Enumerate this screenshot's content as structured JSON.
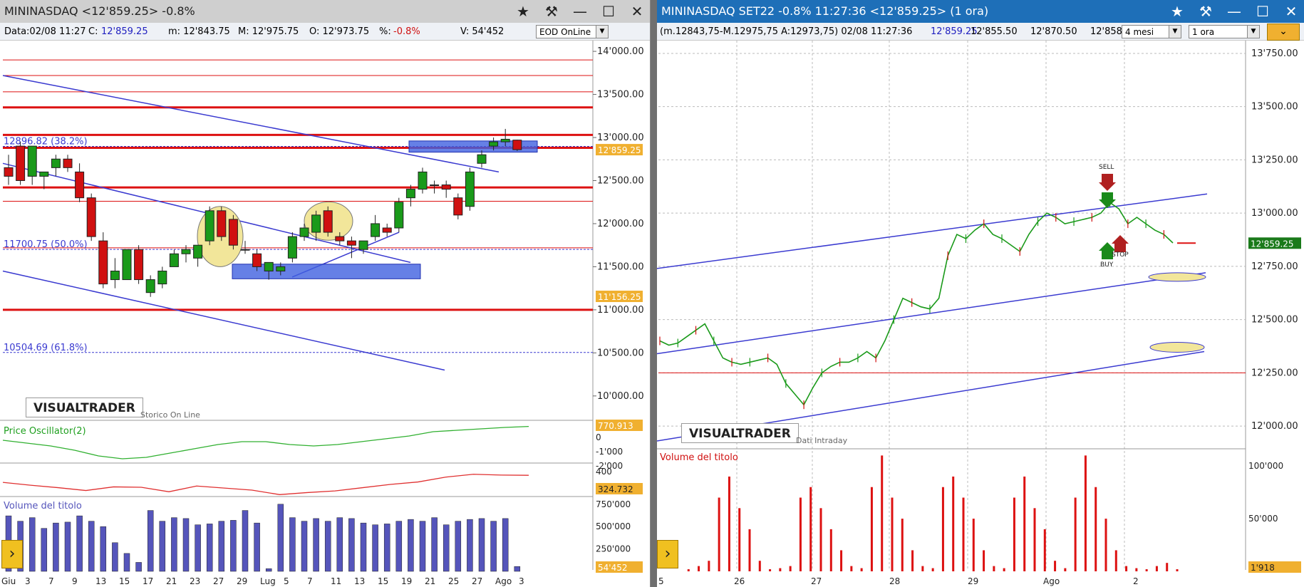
{
  "left": {
    "title": "MININASDAQ <12'859.25> -0.8%",
    "info": {
      "date": "Data:02/08 11:27",
      "close_label": "C:",
      "close": "12'859.25",
      "min": "m: 12'843.75",
      "max": "M: 12'975.75",
      "open": "O: 12'973.75",
      "pct_label": "%:",
      "pct": "-0.8%",
      "volume": "V: 54'452"
    },
    "mode_select": "EOD OnLine",
    "logo": "VISUALTRADER",
    "logo_note": "Storico On Line",
    "osc_label": "Price Oscillator(2)",
    "vol_label": "Volume del titolo",
    "fib": [
      {
        "label": "12896.82 (38.2%)",
        "value": 12896.82
      },
      {
        "label": "11700.75 (50.0%)",
        "value": 11700.75
      },
      {
        "label": "10504.69 (61.8%)",
        "value": 10504.69
      }
    ],
    "price_badges": {
      "last": "12'859.25",
      "low": "11'156.25"
    },
    "osc_badges": {
      "top": "770.913",
      "bottom": "324.732"
    },
    "vol_badge": "54'452",
    "osc_ticks": [
      "0",
      "-1'000",
      "-2'000",
      "400"
    ],
    "x_labels": [
      "Giu",
      "3",
      "7",
      "9",
      "13",
      "15",
      "17",
      "21",
      "23",
      "27",
      "29",
      "Lug",
      "5",
      "7",
      "11",
      "13",
      "15",
      "19",
      "21",
      "25",
      "27",
      "Ago",
      "3"
    ]
  },
  "right": {
    "title": "MININASDAQ SET22 -0.8% 11:27:36 <12'859.25> (1 ora)",
    "info": {
      "range": "(m.12843,75-M.12975,75 A:12973,75) 02/08 11:27:36",
      "last": "12'859.25",
      "bid": "12'855.50",
      "ask": "12'870.50",
      "cut": "12'858."
    },
    "period_select": "4 mesi",
    "interval_select": "1 ora",
    "logo": "VISUALTRADER",
    "logo_note": "Dati Intraday",
    "vol_label": "Volume del titolo",
    "price_badge": "12'859.25",
    "vol_badge": "1'918",
    "signals": {
      "sell": "SELL",
      "buy": "BUY",
      "stop": "STOP"
    },
    "x_labels": [
      "5",
      "26",
      "27",
      "28",
      "29",
      "Ago",
      "2"
    ]
  },
  "colors": {
    "up": "#1a9a1a",
    "down": "#d01010",
    "fib": "#3a3ad0",
    "volume_left": "#5555bb",
    "volume_right": "#dd1111",
    "badge": "#f0b030",
    "badge_green": "#1a7a1a"
  },
  "chart_data": [
    {
      "type": "candlestick",
      "title": "MININASDAQ <12'859.25> -0.8%",
      "ylim": [
        9800,
        14100
      ],
      "y_ticks": [
        10000,
        10500,
        11000,
        11500,
        12000,
        12500,
        13000,
        13500,
        14000
      ],
      "y_tick_labels": [
        "10'000.00",
        "10'500.00",
        "11'000.00",
        "11'500.00",
        "12'000.00",
        "12'500.00",
        "13'000.00",
        "13'500.00",
        "14'000.00"
      ],
      "horizontal_lines": [
        13350,
        13030,
        12880,
        12420,
        12260,
        11720,
        11000,
        13720,
        13900,
        13530
      ],
      "grid": false,
      "candles": [
        [
          12650,
          12800,
          12450,
          12550
        ],
        [
          12900,
          12950,
          12450,
          12500
        ],
        [
          12550,
          12900,
          12450,
          12900
        ],
        [
          12550,
          12600,
          12400,
          12600
        ],
        [
          12650,
          12800,
          12550,
          12750
        ],
        [
          12750,
          12800,
          12600,
          12650
        ],
        [
          12600,
          12700,
          12250,
          12300
        ],
        [
          12300,
          12350,
          11800,
          11850
        ],
        [
          11800,
          11900,
          11250,
          11300
        ],
        [
          11350,
          11600,
          11250,
          11450
        ],
        [
          11350,
          11700,
          11350,
          11700
        ],
        [
          11700,
          11750,
          11300,
          11350
        ],
        [
          11200,
          11400,
          11150,
          11350
        ],
        [
          11300,
          11500,
          11250,
          11450
        ],
        [
          11500,
          11700,
          11500,
          11650
        ],
        [
          11650,
          11750,
          11550,
          11700
        ],
        [
          11600,
          11750,
          11500,
          11750
        ],
        [
          11800,
          12200,
          11750,
          12150
        ],
        [
          12150,
          12200,
          11800,
          11850
        ],
        [
          12050,
          12100,
          11700,
          11750
        ],
        [
          11700,
          11800,
          11650,
          11700
        ],
        [
          11650,
          11700,
          11450,
          11500
        ],
        [
          11450,
          11550,
          11350,
          11550
        ],
        [
          11450,
          11550,
          11400,
          11500
        ],
        [
          11600,
          11900,
          11550,
          11850
        ],
        [
          11850,
          12000,
          11800,
          11950
        ],
        [
          11900,
          12150,
          11800,
          12100
        ],
        [
          12150,
          12200,
          11850,
          11900
        ],
        [
          11850,
          11900,
          11750,
          11800
        ],
        [
          11800,
          11850,
          11600,
          11750
        ],
        [
          11700,
          11800,
          11650,
          11800
        ],
        [
          11850,
          12100,
          11800,
          12000
        ],
        [
          11950,
          12000,
          11850,
          11900
        ],
        [
          11950,
          12300,
          11900,
          12250
        ],
        [
          12300,
          12450,
          12200,
          12400
        ],
        [
          12400,
          12650,
          12350,
          12600
        ],
        [
          12450,
          12500,
          12350,
          12450
        ],
        [
          12450,
          12500,
          12300,
          12400
        ],
        [
          12300,
          12350,
          12050,
          12100
        ],
        [
          12200,
          12650,
          12150,
          12600
        ],
        [
          12700,
          12850,
          12650,
          12800
        ],
        [
          12900,
          13000,
          12850,
          12950
        ],
        [
          12950,
          13100,
          12900,
          12980
        ],
        [
          12970,
          12975,
          12843,
          12859
        ]
      ],
      "oscillator": [
        -200,
        -400,
        -600,
        -900,
        -1300,
        -1500,
        -1400,
        -1100,
        -800,
        -500,
        -300,
        -300,
        -500,
        -600,
        -500,
        -300,
        -100,
        100,
        400,
        500,
        600,
        700,
        770
      ],
      "oscillator2": [
        150,
        80,
        20,
        -50,
        40,
        30,
        -80,
        60,
        10,
        -40,
        -150,
        -100,
        -60,
        20,
        100,
        160,
        280,
        350,
        330,
        324
      ],
      "volume": [
        620,
        560,
        600,
        480,
        540,
        550,
        620,
        560,
        500,
        320,
        200,
        100,
        680,
        560,
        600,
        590,
        520,
        530,
        560,
        570,
        680,
        540,
        30,
        750,
        600,
        560,
        590,
        560,
        600,
        590,
        540,
        520,
        530,
        560,
        580,
        560,
        600,
        520,
        560,
        580,
        590,
        560,
        590,
        54
      ]
    },
    {
      "type": "line",
      "title": "MININASDAQ SET22 -0.8% 11:27:36 <12'859.25> (1 ora)",
      "ylim": [
        11900,
        13800
      ],
      "y_ticks": [
        12000,
        12250,
        12500,
        12750,
        13000,
        13250,
        13500,
        13750
      ],
      "y_tick_labels": [
        "12'000.00",
        "12'250.00",
        "12'500.00",
        "12'750.00",
        "13'000.00",
        "13'250.00",
        "13'500.00",
        "13'750.00"
      ],
      "horizontal_lines": [
        12250
      ],
      "grid": true,
      "prices": [
        12400,
        12380,
        12390,
        12420,
        12450,
        12480,
        12400,
        12320,
        12300,
        12290,
        12300,
        12310,
        12320,
        12290,
        12200,
        12150,
        12100,
        12180,
        12250,
        12280,
        12300,
        12300,
        12320,
        12350,
        12320,
        12400,
        12500,
        12600,
        12580,
        12560,
        12550,
        12600,
        12800,
        12900,
        12880,
        12920,
        12950,
        12900,
        12880,
        12850,
        12820,
        12900,
        12960,
        13000,
        12980,
        12950,
        12960,
        12970,
        12980,
        13000,
        13050,
        13020,
        12950,
        12980,
        12950,
        12920,
        12900,
        12860
      ],
      "volume": [
        0,
        2,
        5,
        10,
        70,
        90,
        60,
        40,
        10,
        2,
        3,
        5,
        70,
        80,
        60,
        40,
        20,
        5,
        3,
        80,
        110,
        70,
        50,
        20,
        5,
        3,
        80,
        90,
        70,
        50,
        20,
        5,
        3,
        70,
        90,
        60,
        40,
        10,
        3,
        70,
        110,
        80,
        50,
        20,
        5,
        3,
        2,
        5,
        8,
        2
      ]
    }
  ]
}
